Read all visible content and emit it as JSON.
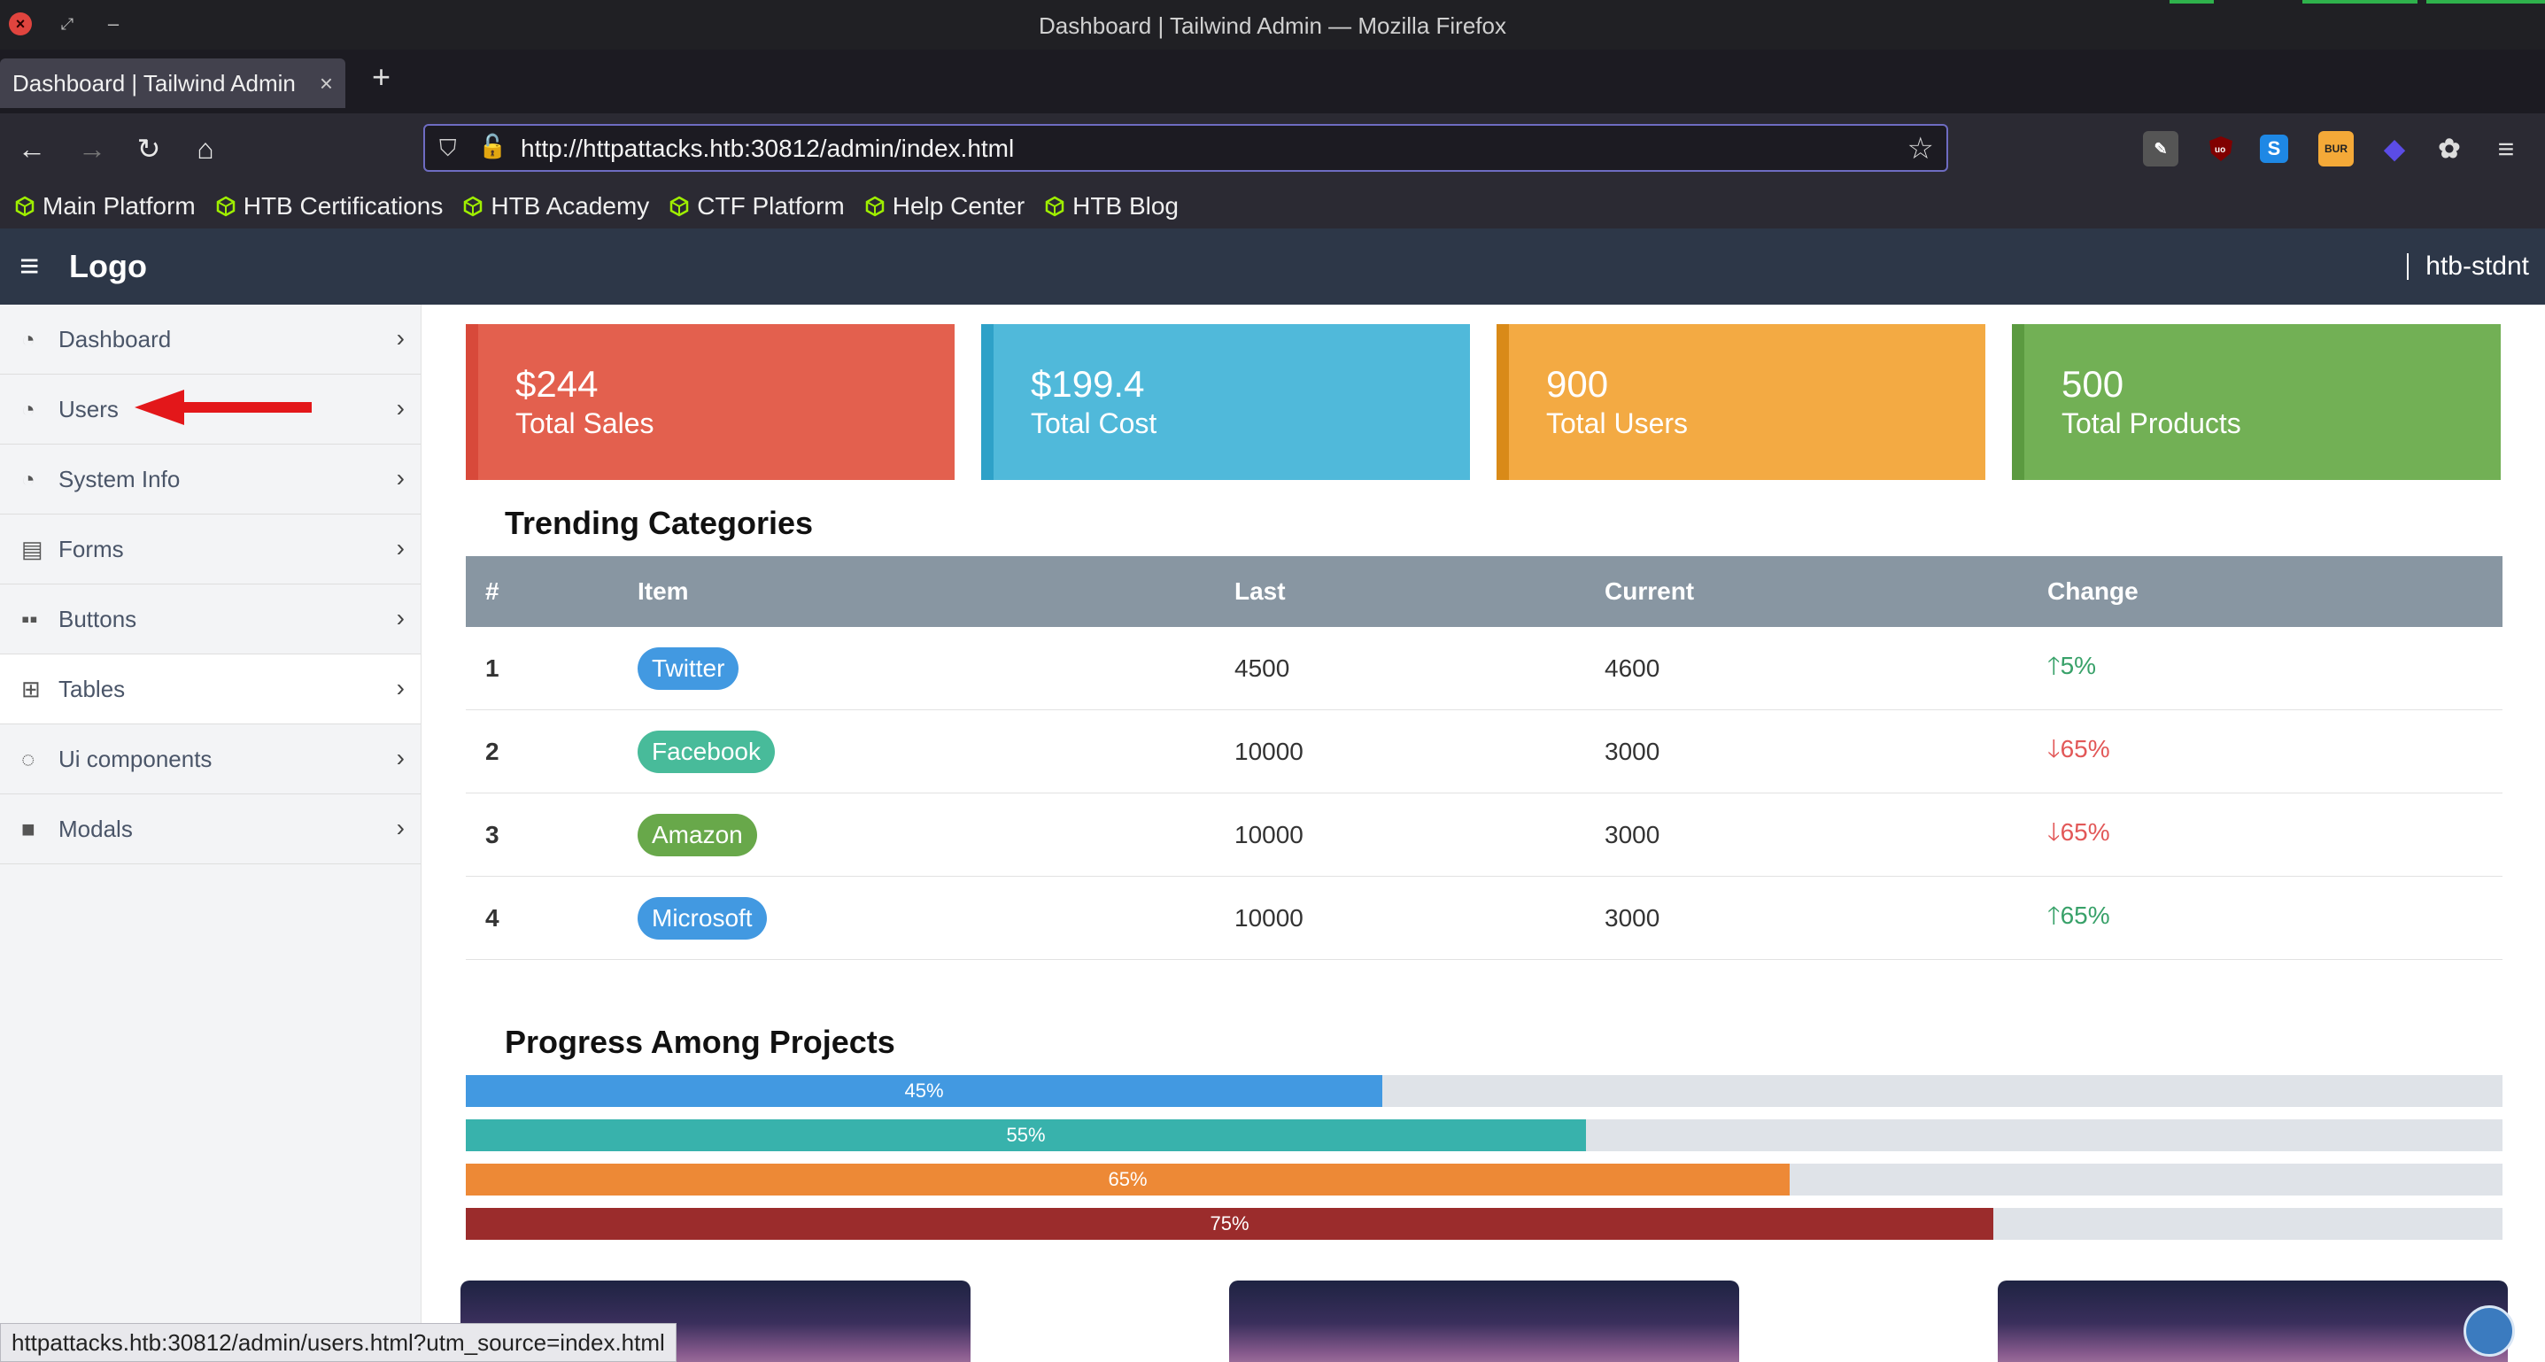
{
  "window": {
    "title": "Dashboard | Tailwind Admin — Mozilla Firefox"
  },
  "browser": {
    "tab_title": "Dashboard | Tailwind Admin",
    "url": "http://httpattacks.htb:30812/admin/index.html",
    "bookmarks": [
      "Main Platform",
      "HTB Certifications",
      "HTB Academy",
      "CTF Platform",
      "Help Center",
      "HTB Blog"
    ],
    "status_text": "httpattacks.htb:30812/admin/users.html?utm_source=index.html"
  },
  "header": {
    "logo": "Logo",
    "username": "htb-stdnt"
  },
  "sidebar": {
    "items": [
      {
        "label": "Dashboard",
        "icon": "gauge-icon"
      },
      {
        "label": "Users",
        "icon": "gauge-icon"
      },
      {
        "label": "System Info",
        "icon": "gauge-icon"
      },
      {
        "label": "Forms",
        "icon": "form-icon"
      },
      {
        "label": "Buttons",
        "icon": "grid-icon"
      },
      {
        "label": "Tables",
        "icon": "table-icon",
        "active": true
      },
      {
        "label": "Ui components",
        "icon": "circle-notch-icon"
      },
      {
        "label": "Modals",
        "icon": "square-icon"
      }
    ]
  },
  "stats": [
    {
      "value": "$244",
      "label": "Total Sales",
      "color": "#e3604e",
      "border": "#d8493a"
    },
    {
      "value": "$199.4",
      "label": "Total Cost",
      "color": "#50b9da",
      "border": "#2ea1c8"
    },
    {
      "value": "900",
      "label": "Total Users",
      "color": "#f3aa43",
      "border": "#d98a18"
    },
    {
      "value": "500",
      "label": "Total Products",
      "color": "#72b055",
      "border": "#5b9a40"
    }
  ],
  "trending": {
    "title": "Trending Categories",
    "headers": [
      "#",
      "Item",
      "Last",
      "Current",
      "Change"
    ],
    "rows": [
      {
        "num": "1",
        "item": "Twitter",
        "item_color": "#4299e1",
        "last": "4500",
        "current": "4600",
        "change": "5%",
        "direction": "up"
      },
      {
        "num": "2",
        "item": "Facebook",
        "item_color": "#48bb9a",
        "last": "10000",
        "current": "3000",
        "change": "65%",
        "direction": "down"
      },
      {
        "num": "3",
        "item": "Amazon",
        "item_color": "#68a84a",
        "last": "10000",
        "current": "3000",
        "change": "65%",
        "direction": "down"
      },
      {
        "num": "4",
        "item": "Microsoft",
        "item_color": "#4299e1",
        "last": "10000",
        "current": "3000",
        "change": "65%",
        "direction": "up"
      }
    ]
  },
  "progress": {
    "title": "Progress Among Projects",
    "bars": [
      {
        "label": "45%",
        "value": 0.45,
        "color": "#4299e1"
      },
      {
        "label": "55%",
        "value": 0.55,
        "color": "#38b2ac"
      },
      {
        "label": "65%",
        "value": 0.65,
        "color": "#ed8936"
      },
      {
        "label": "75%",
        "value": 0.75,
        "color": "#9b2c2c"
      }
    ]
  }
}
